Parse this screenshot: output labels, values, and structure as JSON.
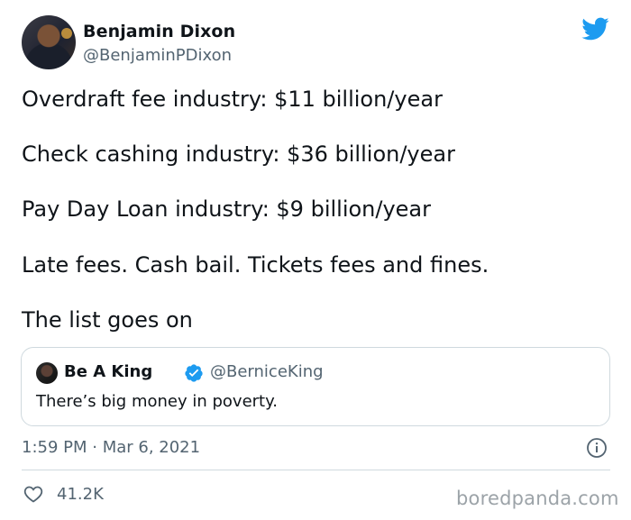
{
  "author": {
    "display_name": "Benjamin Dixon",
    "handle": "@BenjaminPDixon"
  },
  "tweet": {
    "lines": [
      "Overdraft fee industry: $11 billion/year",
      "Check cashing industry: $36 billion/year",
      "Pay Day Loan industry: $9 billion/year",
      "Late fees. Cash bail. Tickets fees and fines.",
      "The list goes on"
    ]
  },
  "quote": {
    "display_name": "Be A King",
    "handle": "@BerniceKing",
    "text": "There’s big money in poverty.",
    "verified": true
  },
  "timestamp": "1:59 PM · Mar 6, 2021",
  "likes": "41.2K",
  "watermark": "boredpanda.com",
  "icons": {
    "platform": "twitter-bird-icon",
    "verified": "verified-badge-icon",
    "info": "info-icon",
    "like": "heart-icon"
  },
  "colors": {
    "accent": "#1d9bf0",
    "text_primary": "#0f1419",
    "text_secondary": "#536471",
    "border": "#cfd9de"
  }
}
